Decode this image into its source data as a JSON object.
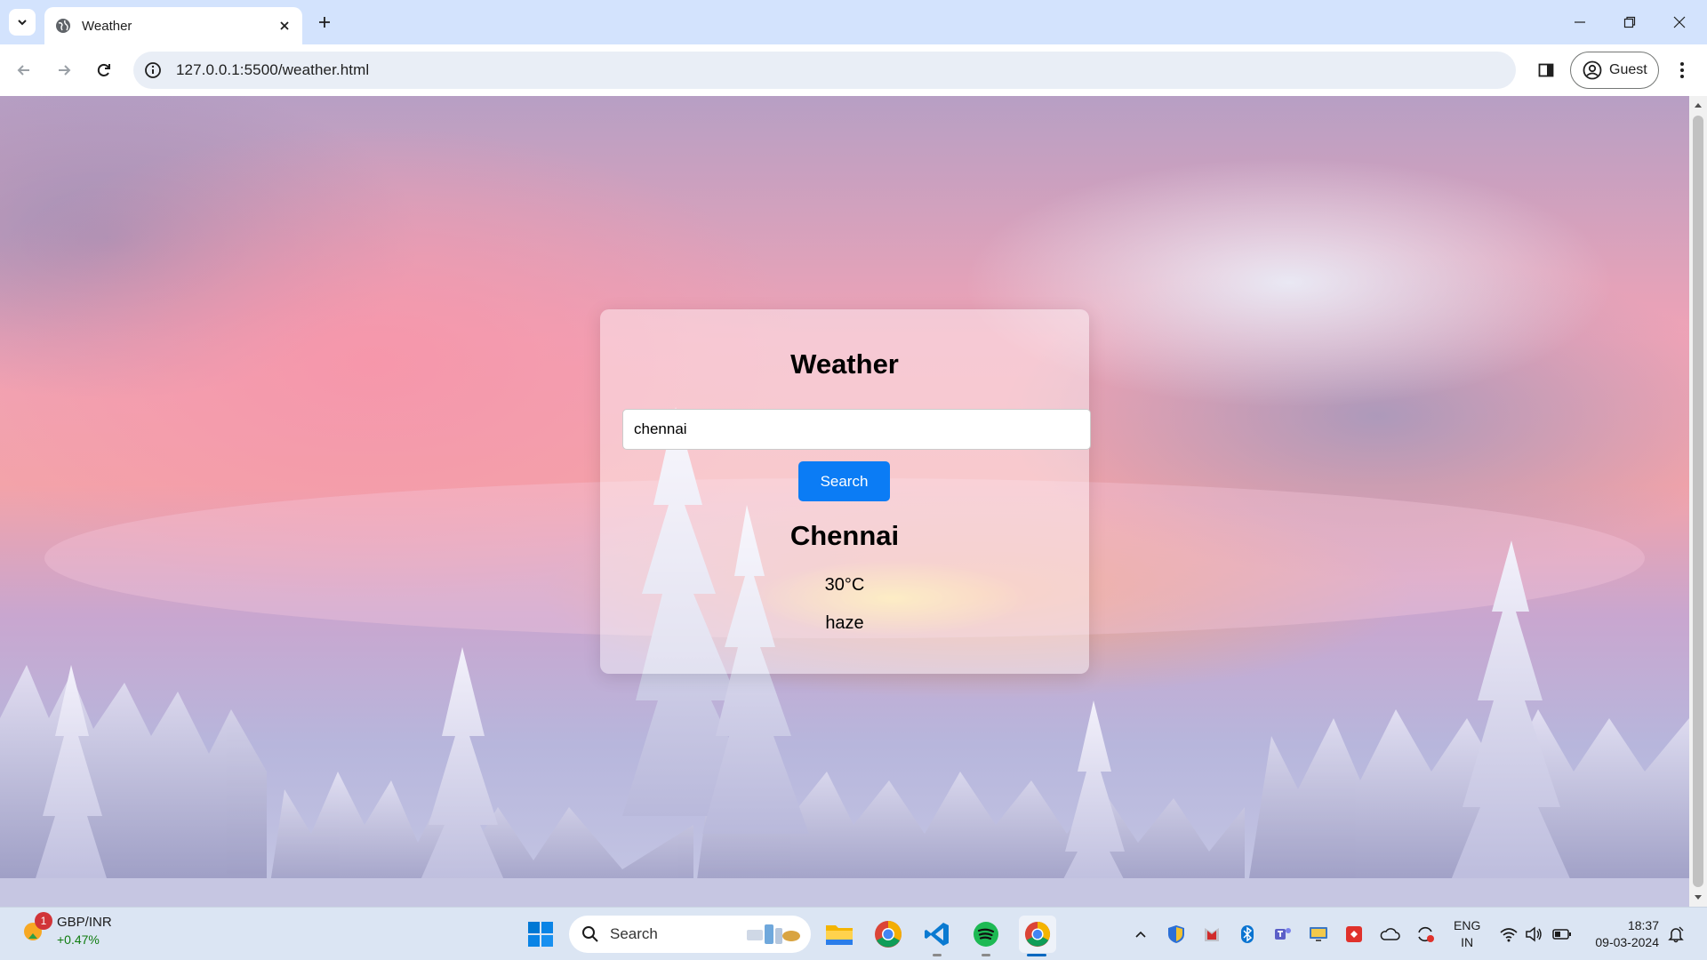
{
  "browser": {
    "tab_title": "Weather",
    "url": "127.0.0.1:5500/weather.html",
    "profile_label": "Guest"
  },
  "weather_card": {
    "heading": "Weather",
    "input_value": "chennai",
    "search_label": "Search",
    "city": "Chennai",
    "temperature": "30°C",
    "description": "haze"
  },
  "taskbar": {
    "widget_badge": "1",
    "widget_title": "GBP/INR",
    "widget_change": "+0.47%",
    "search_label": "Search",
    "lang_line1": "ENG",
    "lang_line2": "IN",
    "time": "18:37",
    "date": "09-03-2024"
  },
  "colors": {
    "accent_button": "#0b7cf5",
    "tabstrip": "#d3e3fd",
    "omnibox": "#e9eef6"
  }
}
